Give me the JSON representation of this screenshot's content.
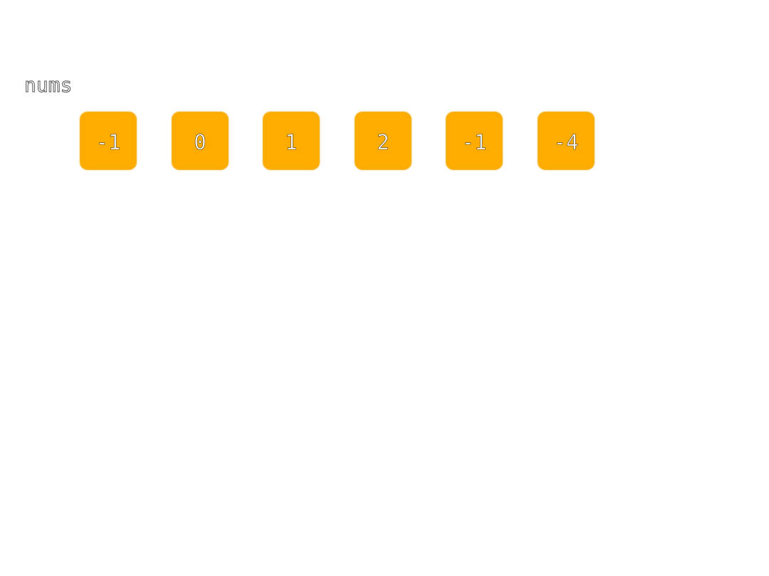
{
  "array": {
    "label": "nums",
    "cell_color": "#ffac00",
    "text_color": "#ffffff",
    "items": [
      {
        "value": "-1"
      },
      {
        "value": "0"
      },
      {
        "value": "1"
      },
      {
        "value": "2"
      },
      {
        "value": "-1"
      },
      {
        "value": "-4"
      }
    ]
  }
}
